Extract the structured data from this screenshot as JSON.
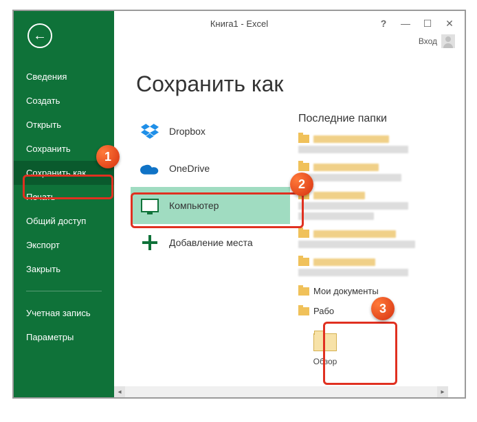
{
  "window": {
    "title": "Книга1 - Excel",
    "login_label": "Вход"
  },
  "sidebar": {
    "items": [
      {
        "label": "Сведения"
      },
      {
        "label": "Создать"
      },
      {
        "label": "Открыть"
      },
      {
        "label": "Сохранить"
      },
      {
        "label": "Сохранить как"
      },
      {
        "label": "Печать"
      },
      {
        "label": "Общий доступ"
      },
      {
        "label": "Экспорт"
      },
      {
        "label": "Закрыть"
      }
    ],
    "footer": [
      {
        "label": "Учетная запись"
      },
      {
        "label": "Параметры"
      }
    ]
  },
  "page": {
    "title": "Сохранить как"
  },
  "places": {
    "items": [
      {
        "label": "Dropbox",
        "icon": "dropbox-icon"
      },
      {
        "label": "OneDrive",
        "icon": "onedrive-icon"
      },
      {
        "label": "Компьютер",
        "icon": "computer-icon",
        "selected": true
      },
      {
        "label": "Добавление места",
        "icon": "plus-icon"
      }
    ]
  },
  "recent": {
    "title": "Последние папки",
    "readable_items": [
      "Мои документы",
      "Рабо"
    ],
    "browse_label": "Обзор"
  },
  "callouts": {
    "n1": "1",
    "n2": "2",
    "n3": "3"
  }
}
